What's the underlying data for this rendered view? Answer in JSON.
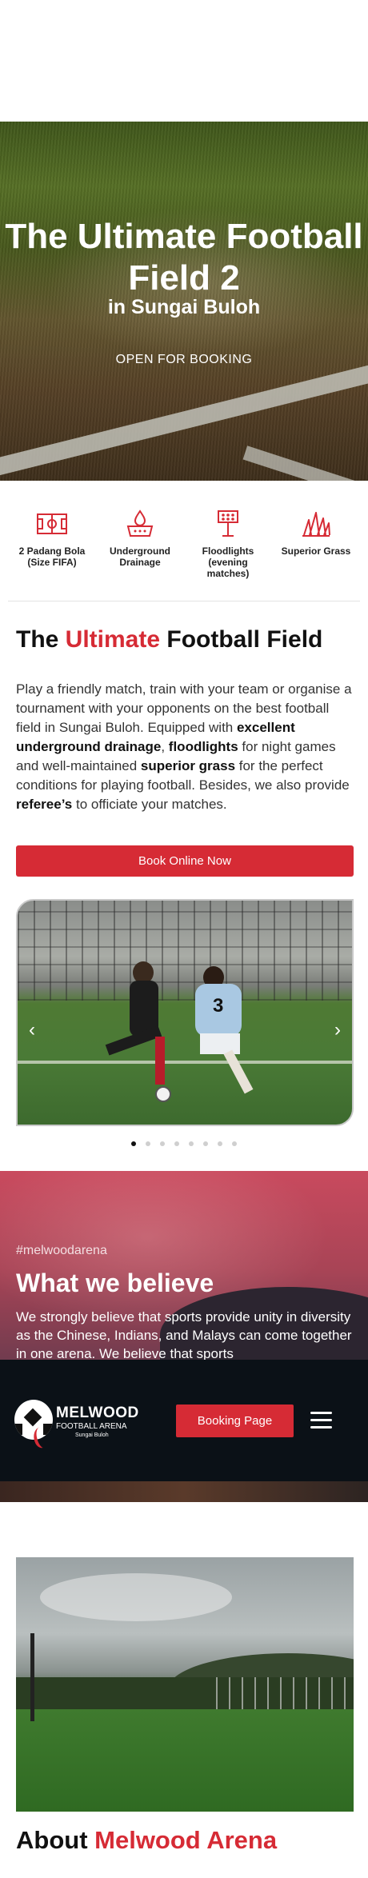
{
  "hero": {
    "title": "The Ultimate Football Field 2",
    "subtitle": "in Sungai Buloh",
    "tagline": "OPEN FOR BOOKING"
  },
  "features": [
    {
      "label": "2 Padang Bola (Size FIFA)",
      "icon": "football-pitch-icon"
    },
    {
      "label": "Underground Drainage",
      "icon": "drainage-icon"
    },
    {
      "label": "Floodlights (evening matches)",
      "icon": "floodlight-icon"
    },
    {
      "label": "Superior Grass",
      "icon": "grass-icon"
    }
  ],
  "about_field": {
    "title_pre": "The ",
    "title_highlight": "Ultimate",
    "title_post": " Football Field",
    "text_1": "Play a friendly match, train with your team or organise a tournament with your opponents on the best football field in Sungai Buloh. Equipped with ",
    "bold_1": "excellent underground drainage",
    "text_2": ", ",
    "bold_2": "floodlights",
    "text_3": " for night games and well-maintained ",
    "bold_3": "superior grass",
    "text_4": " for the perfect conditions for playing football. Besides, we also provide ",
    "bold_4": "referee’s",
    "text_5": " to officiate your matches.",
    "button_label": "Book Online Now"
  },
  "carousel": {
    "prev_icon": "chevron-left-icon",
    "next_icon": "chevron-right-icon",
    "prev_glyph": "‹",
    "next_glyph": "›",
    "jersey_number": "3",
    "slide_count": 8,
    "active_slide": 0
  },
  "believe": {
    "hashtag": "#melwoodarena",
    "title": "What we believe",
    "text": "We strongly believe that sports provide unity in diversity as the Chinese, Indians, and Malays can come together in one arena. We believe that sports"
  },
  "navbar": {
    "logo_name": "MELWOOD",
    "logo_sub": "FOOTBALL ARENA",
    "logo_location": "Sungai Buloh",
    "booking_label": "Booking Page",
    "menu_icon": "hamburger-icon"
  },
  "about_arena": {
    "title_pre": "About ",
    "title_highlight": "Melwood Arena"
  },
  "colors": {
    "accent": "#d62b35",
    "navbar_bg": "#0b1117",
    "text": "#333333"
  }
}
